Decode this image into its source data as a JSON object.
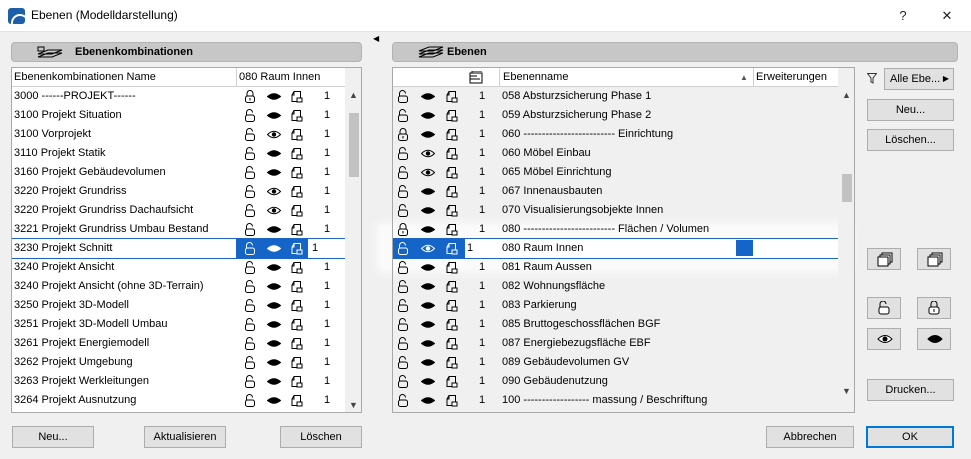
{
  "window": {
    "title": "Ebenen (Modelldarstellung)",
    "help": "?",
    "close": "✕"
  },
  "left": {
    "header": "Ebenenkombinationen",
    "col_name": "Ebenenkombinationen Name",
    "col_value": "080 Raum Innen",
    "rows": [
      {
        "name": "3000 ------PROJEKT------",
        "lock": "locked",
        "eye": "filled",
        "num": "1"
      },
      {
        "name": "3100 Projekt Situation",
        "lock": "unlocked",
        "eye": "filled",
        "num": "1"
      },
      {
        "name": "3100 Vorprojekt",
        "lock": "unlocked",
        "eye": "open",
        "num": "1"
      },
      {
        "name": "3110 Projekt Statik",
        "lock": "unlocked",
        "eye": "filled",
        "num": "1"
      },
      {
        "name": "3160 Projekt Gebäudevolumen",
        "lock": "unlocked",
        "eye": "filled",
        "num": "1"
      },
      {
        "name": "3220 Projekt Grundriss",
        "lock": "unlocked",
        "eye": "open",
        "num": "1"
      },
      {
        "name": "3220 Projekt Grundriss Dachaufsicht",
        "lock": "unlocked",
        "eye": "open",
        "num": "1"
      },
      {
        "name": "3221 Projekt Grundriss Umbau Bestand",
        "lock": "unlocked",
        "eye": "filled",
        "num": "1"
      },
      {
        "name": "3230 Projekt Schnitt",
        "lock": "unlocked",
        "eye": "filled",
        "num": "1",
        "selected": true
      },
      {
        "name": "3240 Projekt Ansicht",
        "lock": "unlocked",
        "eye": "filled",
        "num": "1"
      },
      {
        "name": "3240 Projekt Ansicht (ohne 3D-Terrain)",
        "lock": "unlocked",
        "eye": "filled",
        "num": "1"
      },
      {
        "name": "3250 Projekt 3D-Modell",
        "lock": "unlocked",
        "eye": "filled",
        "num": "1"
      },
      {
        "name": "3251 Projekt 3D-Modell Umbau",
        "lock": "unlocked",
        "eye": "filled",
        "num": "1"
      },
      {
        "name": "3261 Projekt Energiemodell",
        "lock": "unlocked",
        "eye": "filled",
        "num": "1"
      },
      {
        "name": "3262 Projekt Umgebung",
        "lock": "unlocked",
        "eye": "filled",
        "num": "1"
      },
      {
        "name": "3263 Projekt Werkleitungen",
        "lock": "unlocked",
        "eye": "filled",
        "num": "1"
      },
      {
        "name": "3264 Projekt Ausnutzung",
        "lock": "unlocked",
        "eye": "filled",
        "num": "1"
      }
    ],
    "buttons": {
      "new": "Neu...",
      "update": "Aktualisieren",
      "delete": "Löschen"
    }
  },
  "right": {
    "header": "Ebenen",
    "col_name": "Ebenenname",
    "col_ext": "Erweiterungen",
    "rows": [
      {
        "num": "1",
        "name": "058 Absturzsicherung Phase 1",
        "lock": "unlocked",
        "eye": "filled"
      },
      {
        "num": "1",
        "name": "059 Absturzsicherung Phase 2",
        "lock": "unlocked",
        "eye": "filled"
      },
      {
        "num": "1",
        "name": "060 ------------------------- Einrichtung",
        "lock": "locked",
        "eye": "filled"
      },
      {
        "num": "1",
        "name": "060 Möbel Einbau",
        "lock": "unlocked",
        "eye": "open"
      },
      {
        "num": "1",
        "name": "065 Möbel Einrichtung",
        "lock": "unlocked",
        "eye": "open"
      },
      {
        "num": "1",
        "name": "067 Innenausbauten",
        "lock": "unlocked",
        "eye": "filled"
      },
      {
        "num": "1",
        "name": "070 Visualisierungsobjekte Innen",
        "lock": "unlocked",
        "eye": "filled"
      },
      {
        "num": "1",
        "name": "080 ------------------------- Flächen / Volumen",
        "lock": "locked",
        "eye": "filled"
      },
      {
        "num": "1",
        "name": "080 Raum Innen",
        "lock": "unlocked",
        "eye": "open",
        "selected": true
      },
      {
        "num": "1",
        "name": "081 Raum Aussen",
        "lock": "unlocked",
        "eye": "filled"
      },
      {
        "num": "1",
        "name": "082 Wohnungsfläche",
        "lock": "unlocked",
        "eye": "filled"
      },
      {
        "num": "1",
        "name": "083 Parkierung",
        "lock": "unlocked",
        "eye": "filled"
      },
      {
        "num": "1",
        "name": "085 Bruttogeschossflächen BGF",
        "lock": "unlocked",
        "eye": "filled"
      },
      {
        "num": "1",
        "name": "087 Energiebezugsfläche EBF",
        "lock": "unlocked",
        "eye": "filled"
      },
      {
        "num": "1",
        "name": "089 Gebäudevolumen GV",
        "lock": "unlocked",
        "eye": "filled"
      },
      {
        "num": "1",
        "name": "090 Gebäudenutzung",
        "lock": "unlocked",
        "eye": "filled"
      },
      {
        "num": "1",
        "name": "100 ------------------ massung / Beschriftung",
        "lock": "unlocked",
        "eye": "filled"
      }
    ],
    "filter_label": "Alle Ebe...",
    "side_buttons": {
      "new": "Neu...",
      "delete": "Löschen...",
      "print": "Drucken..."
    },
    "buttons": {
      "cancel": "Abbrechen",
      "ok": "OK"
    }
  },
  "colors": {
    "selection": "#1565c8",
    "panel_header": "#c7c7c7",
    "default_border": "#0078d7"
  }
}
